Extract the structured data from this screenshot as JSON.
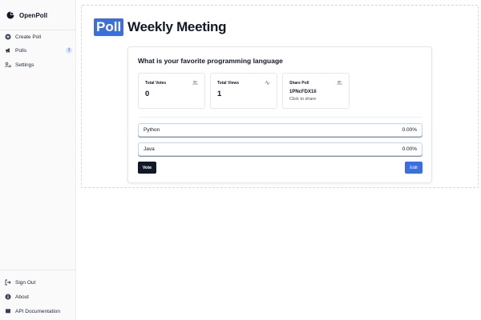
{
  "app": {
    "name": "OpenPoll"
  },
  "sidebar": {
    "items": [
      {
        "label": "Create Poll",
        "icon": "plus-circle-icon"
      },
      {
        "label": "Polls",
        "icon": "megaphone-icon",
        "badge": "3"
      },
      {
        "label": "Settings",
        "icon": "users-settings-icon"
      }
    ],
    "footer": [
      {
        "label": "Sign Out",
        "icon": "sign-out-icon"
      },
      {
        "label": "About",
        "icon": "info-icon"
      },
      {
        "label": "API Documentation",
        "icon": "book-icon"
      }
    ]
  },
  "page": {
    "title_badge": "Poll",
    "title": "Weekly Meeting",
    "question": "What is your favorite programming language",
    "stats": [
      {
        "label": "Total Votes",
        "value": "0",
        "icon": "users-icon"
      },
      {
        "label": "Total Views",
        "value": "1",
        "icon": "activity-icon"
      },
      {
        "label": "Share Poll",
        "code": "1PNcFDX1li",
        "hint": "Click to share",
        "icon": "users-icon"
      }
    ],
    "options": [
      {
        "label": "Python",
        "percent": "0.00%"
      },
      {
        "label": "Java",
        "percent": "0.00%"
      }
    ],
    "vote_label": "Vote",
    "edit_label": "Edit"
  },
  "colors": {
    "accent": "#3b6fe0",
    "dark": "#111827",
    "badge_bg": "#dbe6fb"
  }
}
